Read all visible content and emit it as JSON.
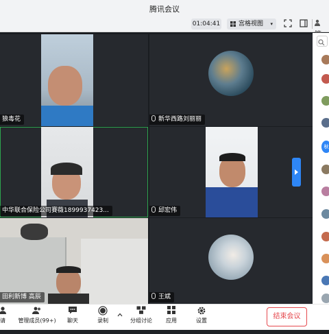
{
  "window": {
    "title": "腾讯会议"
  },
  "toolbar": {
    "timer": "01:04:41",
    "view_label": "宫格视图",
    "view_chevron": "▾",
    "icons": [
      "fullscreen-icon",
      "layout-icon",
      "sidebar-icon"
    ],
    "user_label": "管"
  },
  "participants": [
    {
      "name": "狼毒花",
      "muted": false
    },
    {
      "name": "新华西路刘丽丽",
      "muted": false
    },
    {
      "name": "中华联合保险公司賽薇18999374230",
      "display_name": "中华联合保险公司賽薇1899937423...",
      "muted": false
    },
    {
      "name": "邱宏伟",
      "muted": false
    },
    {
      "name": "田利新博 高辰",
      "muted": false
    },
    {
      "name": "王斌",
      "muted": false
    }
  ],
  "side_panel": {
    "tag_label": "秋"
  },
  "bottom_bar": {
    "items": [
      {
        "label": "请",
        "icon": "invite-icon"
      },
      {
        "label": "管理成员(99+)",
        "icon": "members-icon"
      },
      {
        "label": "聊天",
        "icon": "chat-icon"
      },
      {
        "label": "录制",
        "icon": "record-icon"
      },
      {
        "label": "分组讨论",
        "icon": "breakout-icon"
      },
      {
        "label": "应用",
        "icon": "apps-icon"
      },
      {
        "label": "设置",
        "icon": "settings-icon"
      }
    ],
    "end_label": "结束会议"
  },
  "colors": {
    "accent": "#2e86f6",
    "end_red": "#e5484d",
    "active_border": "#2ea44f"
  }
}
